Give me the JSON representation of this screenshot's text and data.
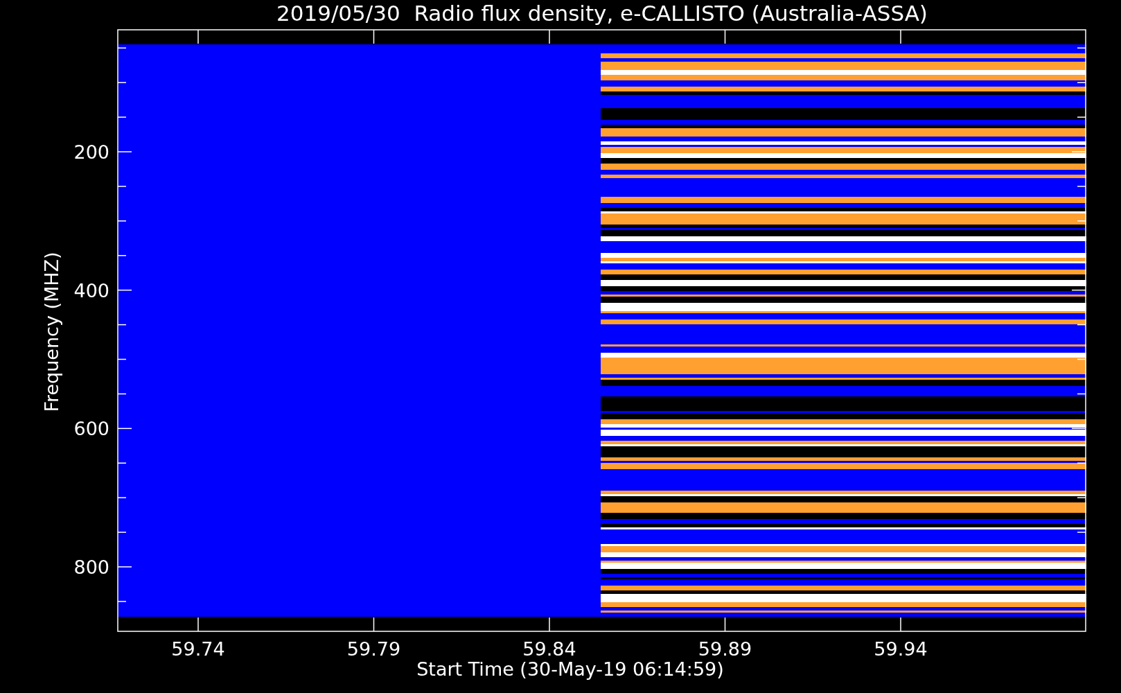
{
  "title": "2019/05/30  Radio flux density, e-CALLISTO (Australia-ASSA)",
  "plot": {
    "ylabel": "Frequency (MHZ)",
    "xlabel": "Start Time (30-May-19 06:14:59)",
    "yticks": [
      "200",
      "400",
      "600",
      "800"
    ],
    "xticks": [
      "59.74",
      "59.79",
      "59.84",
      "59.89",
      "59.94"
    ]
  }
}
